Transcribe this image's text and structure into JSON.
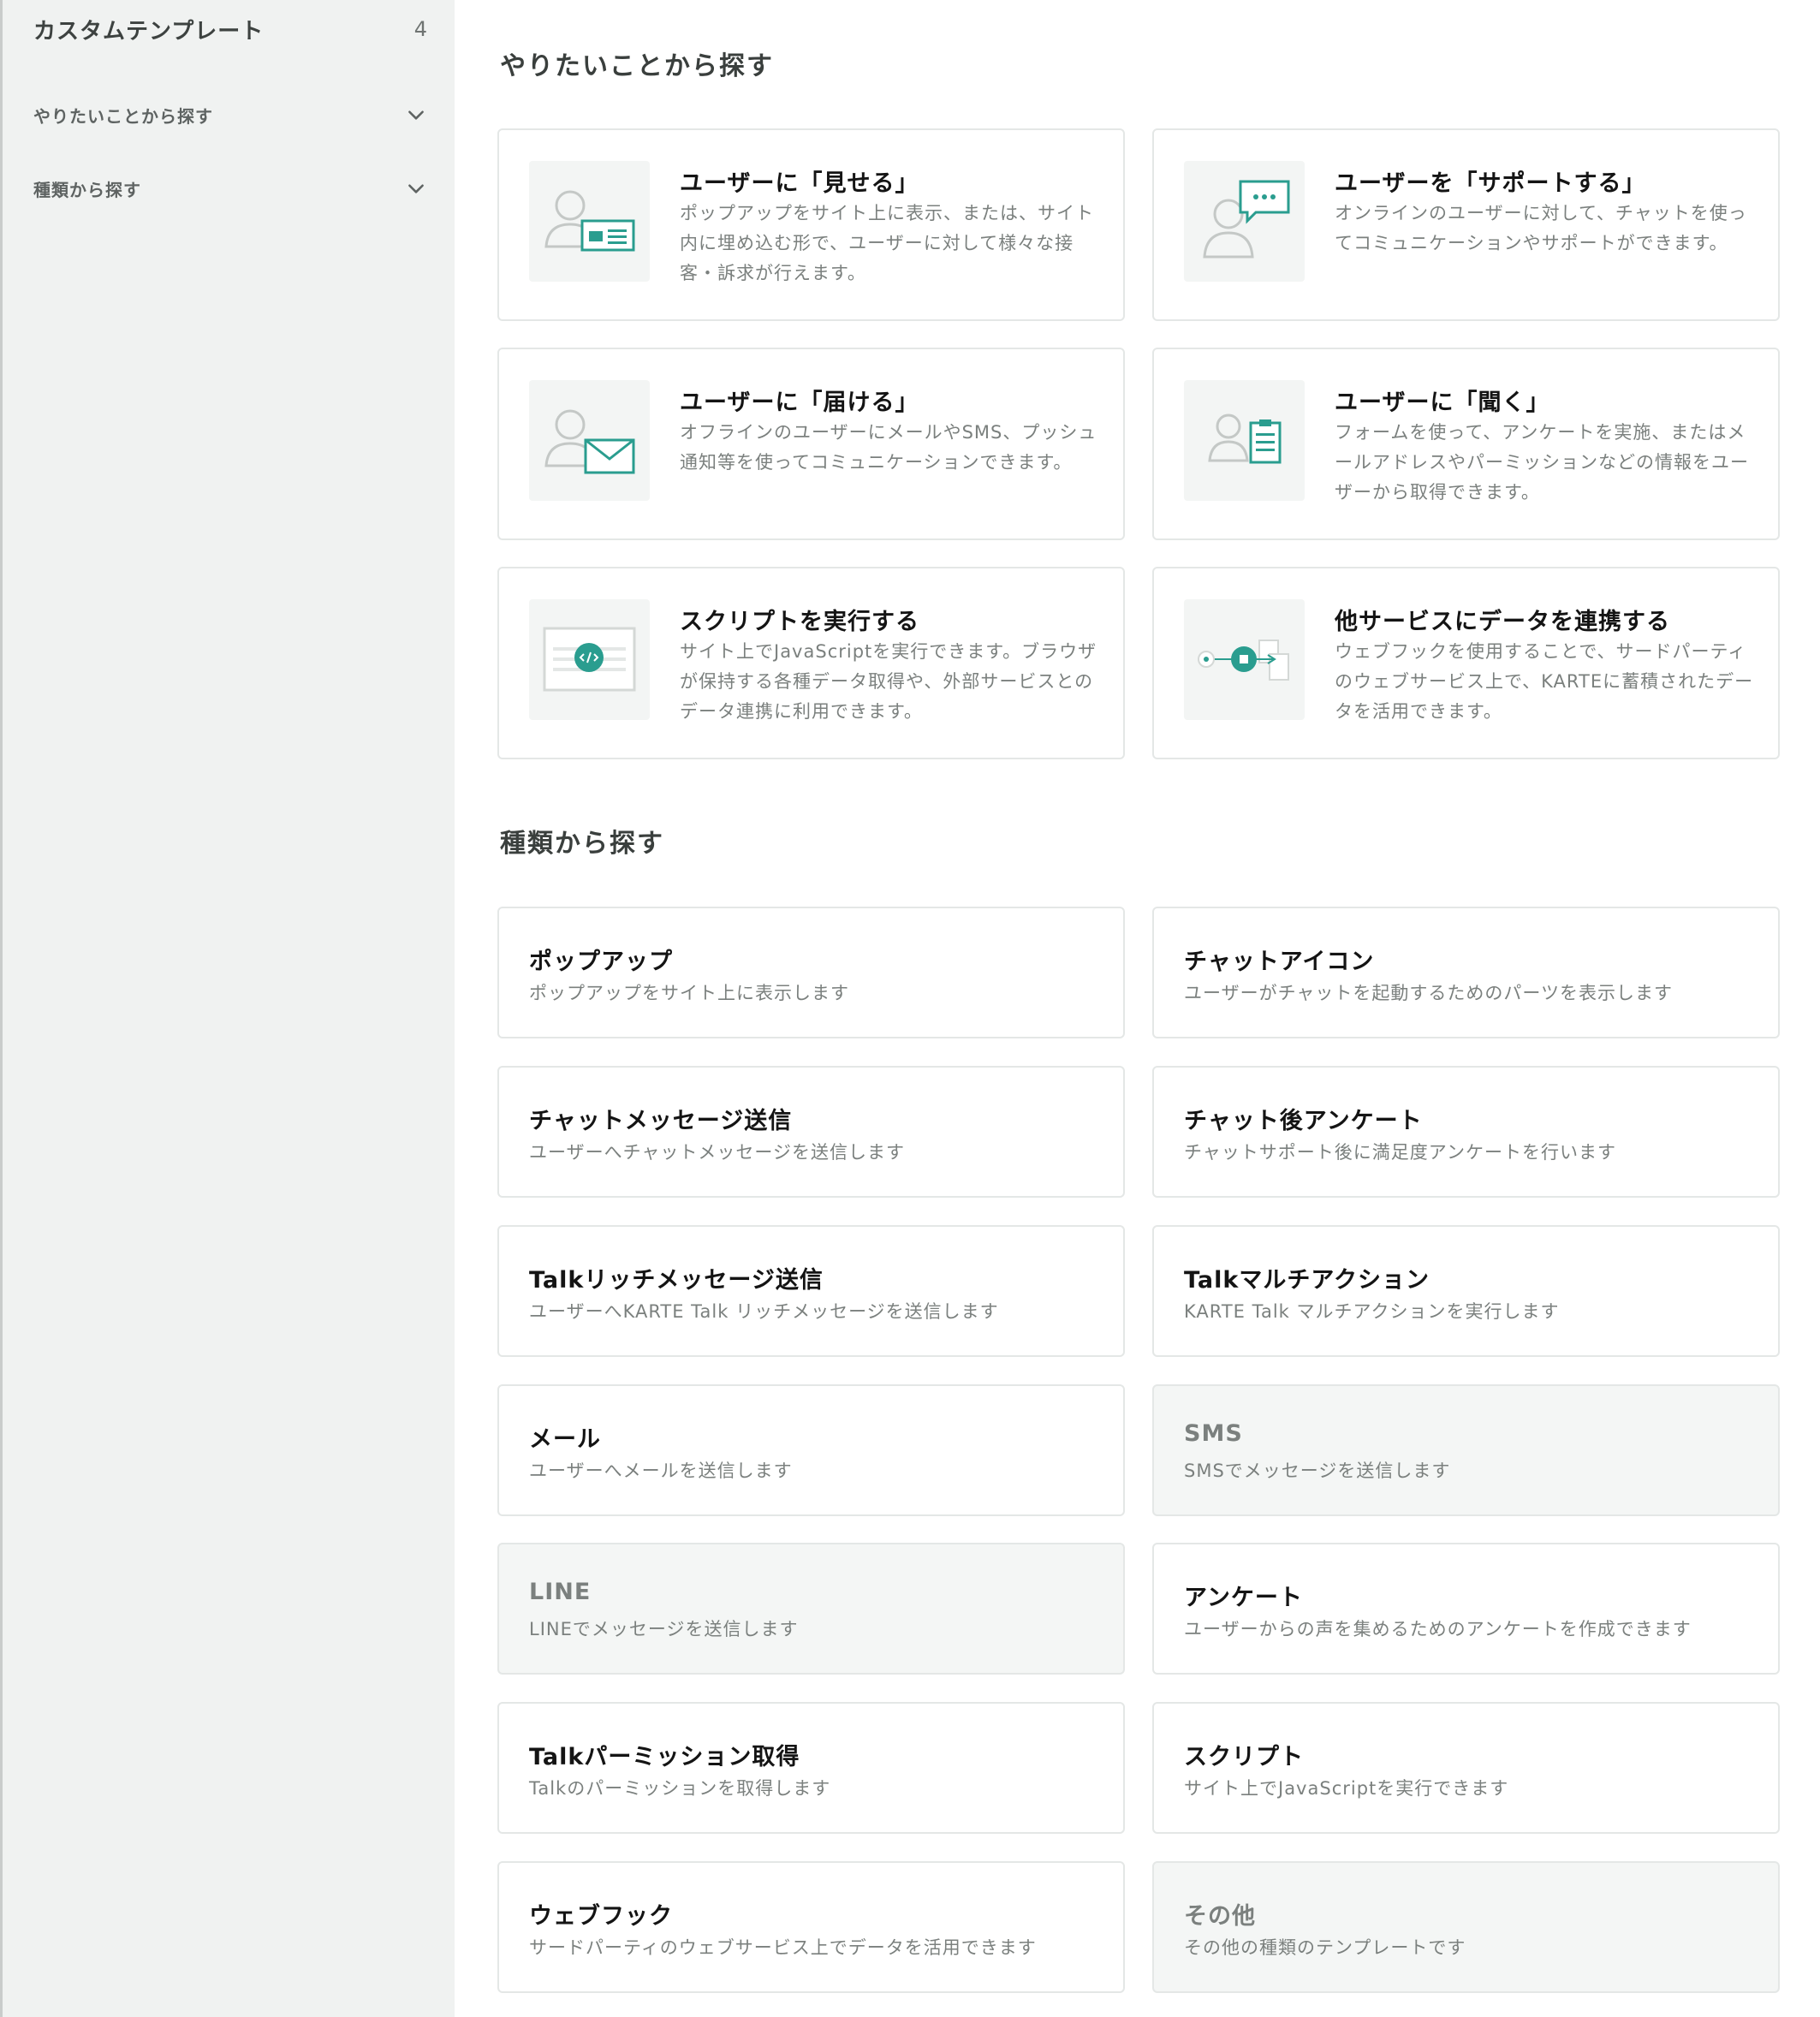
{
  "sidebar": {
    "title": "カスタムテンプレート",
    "count": "4",
    "items": [
      {
        "label": "やりたいことから探す"
      },
      {
        "label": "種類から探す"
      }
    ]
  },
  "purpose_section": {
    "title": "やりたいことから探す",
    "cards": [
      {
        "title": "ユーザーに「見せる」",
        "desc": "ポップアップをサイト上に表示、または、サイト内に埋め込む形で、ユーザーに対して様々な接客・訴求が行えます。",
        "icon": "user-popup-icon"
      },
      {
        "title": "ユーザーを「サポートする」",
        "desc": "オンラインのユーザーに対して、チャットを使ってコミュニケーションやサポートができます。",
        "icon": "user-chat-icon"
      },
      {
        "title": "ユーザーに「届ける」",
        "desc": "オフラインのユーザーにメールやSMS、プッシュ通知等を使ってコミュニケーションできます。",
        "icon": "user-mail-icon"
      },
      {
        "title": "ユーザーに「聞く」",
        "desc": "フォームを使って、アンケートを実施、またはメールアドレスやパーミッションなどの情報をユーザーから取得できます。",
        "icon": "user-form-icon"
      },
      {
        "title": "スクリプトを実行する",
        "desc": "サイト上でJavaScriptを実行できます。ブラウザが保持する各種データ取得や、外部サービスとのデータ連携に利用できます。",
        "icon": "script-icon"
      },
      {
        "title": "他サービスにデータを連携する",
        "desc": "ウェブフックを使用することで、サードパーティのウェブサービス上で、KARTEに蓄積されたデータを活用できます。",
        "icon": "webhook-icon"
      }
    ]
  },
  "type_section": {
    "title": "種類から探す",
    "cards": [
      {
        "title": "ポップアップ",
        "desc": "ポップアップをサイト上に表示します",
        "disabled": false
      },
      {
        "title": "チャットアイコン",
        "desc": "ユーザーがチャットを起動するためのパーツを表示します",
        "disabled": false
      },
      {
        "title": "チャットメッセージ送信",
        "desc": "ユーザーへチャットメッセージを送信します",
        "disabled": false
      },
      {
        "title": "チャット後アンケート",
        "desc": "チャットサポート後に満足度アンケートを行います",
        "disabled": false
      },
      {
        "title": "Talkリッチメッセージ送信",
        "desc": "ユーザーへKARTE Talk リッチメッセージを送信します",
        "disabled": false
      },
      {
        "title": "Talkマルチアクション",
        "desc": "KARTE Talk マルチアクションを実行します",
        "disabled": false
      },
      {
        "title": "メール",
        "desc": "ユーザーへメールを送信します",
        "disabled": false
      },
      {
        "title": "SMS",
        "desc": "SMSでメッセージを送信します",
        "disabled": true
      },
      {
        "title": "LINE",
        "desc": "LINEでメッセージを送信します",
        "disabled": true
      },
      {
        "title": "アンケート",
        "desc": "ユーザーからの声を集めるためのアンケートを作成できます",
        "disabled": false
      },
      {
        "title": "Talkパーミッション取得",
        "desc": "Talkのパーミッションを取得します",
        "disabled": false
      },
      {
        "title": "スクリプト",
        "desc": "サイト上でJavaScriptを実行できます",
        "disabled": false
      },
      {
        "title": "ウェブフック",
        "desc": "サードパーティのウェブサービス上でデータを活用できます",
        "disabled": false
      },
      {
        "title": "その他",
        "desc": "その他の種類のテンプレートです",
        "disabled": true
      }
    ]
  },
  "colors": {
    "accent": "#2a9d8f",
    "sidebar_bg": "#f0f2f1",
    "card_border": "#e4e7e6",
    "disabled_bg": "#f4f6f5"
  }
}
